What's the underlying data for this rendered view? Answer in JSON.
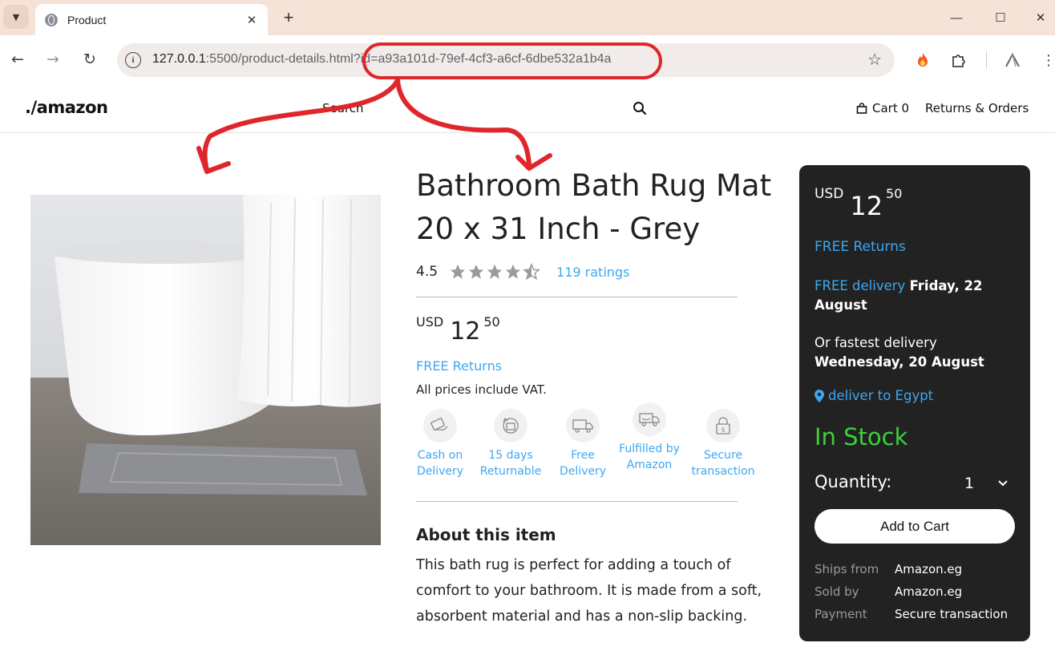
{
  "browser": {
    "tab_title": "Product",
    "url_host": "127.0.0.1",
    "url_path": ":5500/product-details.html?id=a93a101d-79ef-4cf3-a6cf-6dbe532a1b4a"
  },
  "header": {
    "logo": "./amazon",
    "search_label": "Search",
    "cart_label": "Cart 0",
    "returns_label": "Returns & Orders"
  },
  "product": {
    "title": "Bathroom Bath Rug Mat 20 x 31 Inch - Grey",
    "rating_value": "4.5",
    "rating_stars": 4.5,
    "ratings_count": "119 ratings",
    "price": {
      "currency": "USD",
      "whole": "12",
      "fraction": "50"
    },
    "free_returns": "FREE Returns",
    "vat_note": "All prices include VAT.",
    "features": [
      {
        "icon": "cash-icon",
        "label": "Cash on Delivery"
      },
      {
        "icon": "return-icon",
        "label": "15 days Returnable"
      },
      {
        "icon": "truck-icon",
        "label": "Free Delivery"
      },
      {
        "icon": "fulfilled-truck-icon",
        "label": "Fulfilled by Amazon"
      },
      {
        "icon": "lock-icon",
        "label": "Secure transaction"
      }
    ],
    "about_title": "About this item",
    "about_text": "This bath rug is perfect for adding a touch of comfort to your bathroom. It is made from a soft, absorbent material and has a non-slip backing."
  },
  "buybox": {
    "price": {
      "currency": "USD",
      "whole": "12",
      "fraction": "50"
    },
    "free_returns": "FREE Returns",
    "free_delivery_label": "FREE delivery",
    "free_delivery_date": "Friday, 22 August",
    "fastest_label": "Or fastest delivery",
    "fastest_date": "Wednesday, 20 August",
    "deliver_to": "deliver to Egypt",
    "stock": "In Stock",
    "quantity_label": "Quantity:",
    "quantity_value": "1",
    "add_to_cart": "Add to Cart",
    "meta": [
      {
        "key": "Ships from",
        "value": "Amazon.eg"
      },
      {
        "key": "Sold by",
        "value": "Amazon.eg"
      },
      {
        "key": "Payment",
        "value": "Secure transaction"
      }
    ]
  },
  "colors": {
    "link_blue": "#3ea7f0",
    "stock_green": "#3ad13a",
    "annotation_red": "#e0262a",
    "buybox_bg": "#222222"
  }
}
